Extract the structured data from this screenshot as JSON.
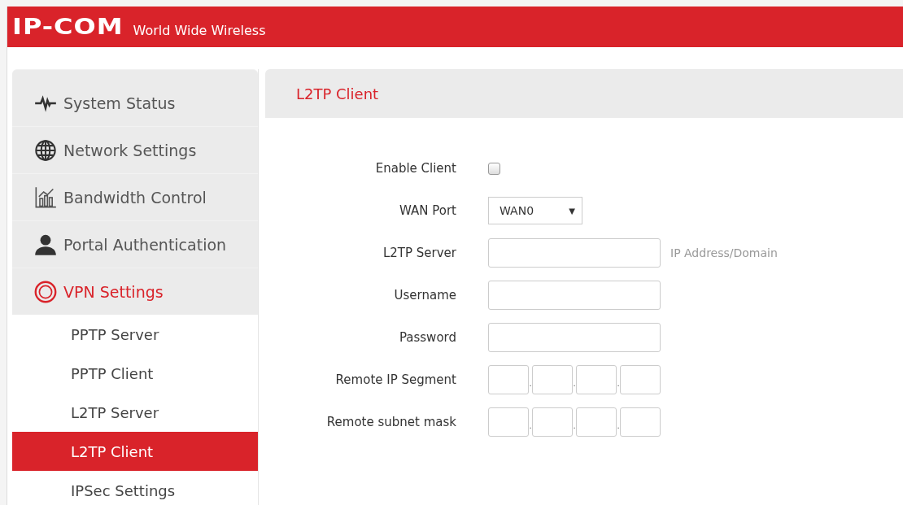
{
  "header": {
    "logo": "IP-COM",
    "tagline": "World Wide Wireless"
  },
  "sidebar": {
    "items": [
      {
        "label": "System Status",
        "kind": "pulse",
        "selected": false
      },
      {
        "label": "Network Settings",
        "kind": "globe",
        "selected": false
      },
      {
        "label": "Bandwidth Control",
        "kind": "chart",
        "selected": false
      },
      {
        "label": "Portal Authentication",
        "kind": "person",
        "selected": false
      },
      {
        "label": "VPN Settings",
        "kind": "vpn",
        "selected": true,
        "children": [
          {
            "label": "PPTP Server",
            "selected": false
          },
          {
            "label": "PPTP Client",
            "selected": false
          },
          {
            "label": "L2TP Server",
            "selected": false
          },
          {
            "label": "L2TP Client",
            "selected": true
          },
          {
            "label": "IPSec Settings",
            "selected": false
          }
        ]
      }
    ]
  },
  "panel": {
    "title": "L2TP Client",
    "fields": [
      {
        "kind": "checkbox",
        "label": "Enable Client",
        "checked": false
      },
      {
        "kind": "select",
        "label": "WAN Port",
        "value": "WAN0",
        "caret": "▼"
      },
      {
        "kind": "text",
        "label": "L2TP Server",
        "hint": "IP Address/Domain"
      },
      {
        "kind": "text",
        "label": "Username"
      },
      {
        "kind": "text",
        "label": "Password"
      },
      {
        "kind": "ip",
        "label": "Remote IP Segment",
        "separator": "."
      },
      {
        "kind": "ip",
        "label": "Remote subnet mask",
        "separator": "."
      }
    ]
  }
}
